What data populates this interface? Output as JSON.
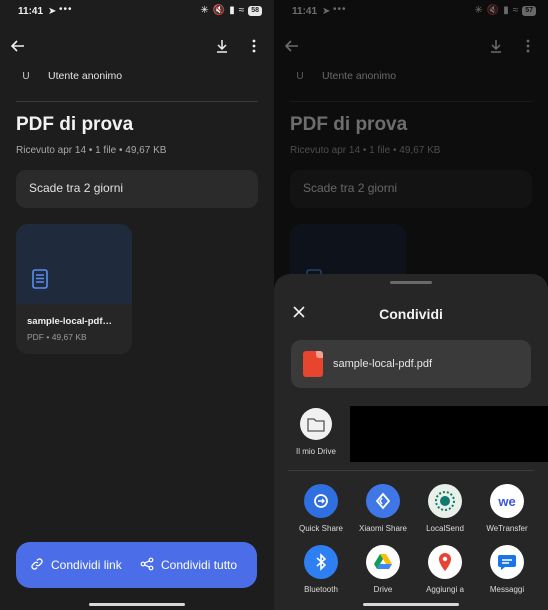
{
  "status": {
    "time": "11:41",
    "extra": "•••",
    "battery_left": "58",
    "battery_right": "57"
  },
  "screen": {
    "sender_initial": "U",
    "sender_name": "Utente anonimo",
    "title": "PDF di prova",
    "meta": "Ricevuto apr 14 • 1 file • 49,67 KB",
    "expires": "Scade tra 2 giorni",
    "file": {
      "name": "sample-local-pdf…",
      "meta": "PDF • 49,67 KB"
    },
    "share_link_label": "Condividi link",
    "share_all_label": "Condividi tutto"
  },
  "share_sheet": {
    "title": "Condividi",
    "file_name": "sample-local-pdf.pdf",
    "contact_label": "Il mio Drive",
    "apps": [
      {
        "label": "Quick Share",
        "icon": "quick-share-icon",
        "color": "#2f6fe0"
      },
      {
        "label": "Xiaomi Share",
        "icon": "xiaomi-share-icon",
        "color": "#3f78e6"
      },
      {
        "label": "LocalSend",
        "icon": "localsend-icon",
        "color": "#e9efe9"
      },
      {
        "label": "WeTransfer",
        "icon": "wetransfer-icon",
        "color": "#ffffff"
      },
      {
        "label": "Bluetooth",
        "icon": "bluetooth-icon",
        "color": "#2d7ff2"
      },
      {
        "label": "Drive",
        "icon": "drive-icon",
        "color": "#ffffff"
      },
      {
        "label": "Aggiungi a",
        "icon": "maps-icon",
        "color": "#ffffff"
      },
      {
        "label": "Messaggi",
        "icon": "messages-icon",
        "color": "#ffffff"
      }
    ]
  },
  "colors": {
    "accent": "#4b6ee8",
    "background": "#1d1d1d",
    "surface": "#2b2b2b"
  }
}
